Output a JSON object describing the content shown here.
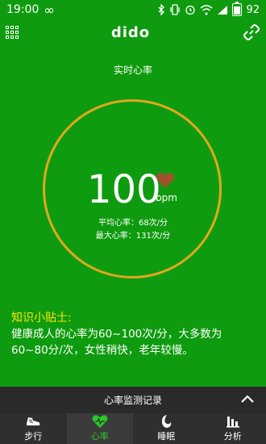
{
  "status_bar": {
    "time": "19:00",
    "infinity": "∞",
    "battery_level": "92",
    "icons": [
      "bluetooth-icon",
      "vibrate-icon",
      "alarm-icon",
      "wifi-icon",
      "signal-icon",
      "battery-icon"
    ]
  },
  "header": {
    "title": "dido",
    "left_icon": "grid-menu-icon",
    "right_icon": "link-icon"
  },
  "heart": {
    "section_label": "实时心率",
    "value": "100",
    "unit": "bpm",
    "avg_line": "平均心率：68次/分",
    "max_line": "最大心率：131次/分",
    "ring_color": "#e0a81e",
    "heart_color": "#a0522d"
  },
  "tips": {
    "title": "知识小贴士:",
    "line1": "健康成人的心率为60~100次/分，大多数为",
    "line2": "60~80分/次，女性稍快，老年较慢。"
  },
  "records": {
    "label": "心率监测记录"
  },
  "tabs": [
    {
      "label": "步行",
      "icon": "shoe-icon"
    },
    {
      "label": "心率",
      "icon": "heart-icon"
    },
    {
      "label": "睡眠",
      "icon": "moon-icon"
    },
    {
      "label": "分析",
      "icon": "bar-chart-icon"
    }
  ],
  "colors": {
    "background": "#0f9b0f",
    "accent_yellow": "#ffe600",
    "tab_active": "#28c828"
  }
}
